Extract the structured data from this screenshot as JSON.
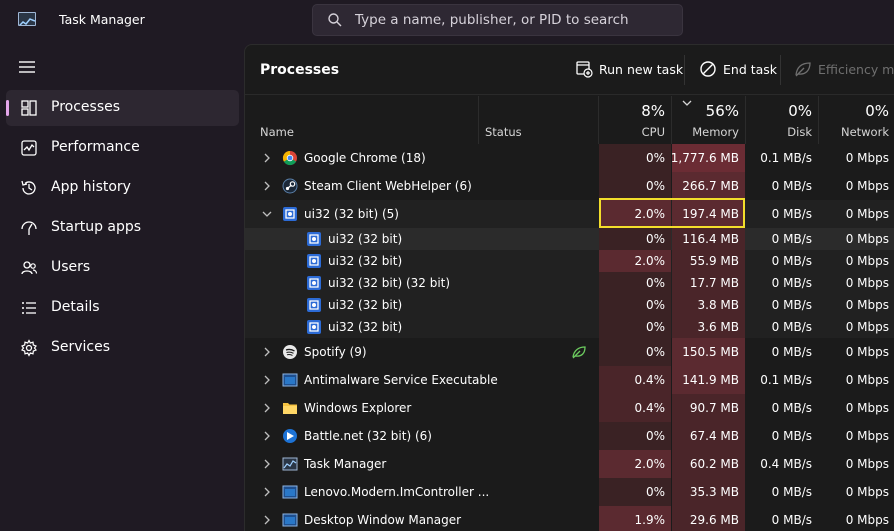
{
  "window": {
    "title": "Task Manager"
  },
  "search": {
    "placeholder": "Type a name, publisher, or PID to search"
  },
  "sidebar": {
    "items": [
      {
        "label": "Processes",
        "icon": "processes-icon",
        "active": true
      },
      {
        "label": "Performance",
        "icon": "performance-icon",
        "active": false
      },
      {
        "label": "App history",
        "icon": "history-icon",
        "active": false
      },
      {
        "label": "Startup apps",
        "icon": "startup-icon",
        "active": false
      },
      {
        "label": "Users",
        "icon": "users-icon",
        "active": false
      },
      {
        "label": "Details",
        "icon": "details-icon",
        "active": false
      },
      {
        "label": "Services",
        "icon": "services-icon",
        "active": false
      }
    ]
  },
  "toolbar": {
    "title": "Processes",
    "run_new_task": "Run new task",
    "end_task": "End task",
    "efficiency_mode": "Efficiency mod"
  },
  "columns": {
    "name": "Name",
    "status": "Status",
    "cpu": {
      "pct": "8%",
      "label": "CPU"
    },
    "memory": {
      "pct": "56%",
      "label": "Memory"
    },
    "disk": {
      "pct": "0%",
      "label": "Disk"
    },
    "network": {
      "pct": "0%",
      "label": "Network"
    }
  },
  "colors": {
    "accent": "#e4a6ea",
    "highlight": "#f3de2b",
    "heat_low": "#3a2224",
    "heat_med": "#4a2529",
    "heat_high": "#5b2a30"
  },
  "processes": [
    {
      "name": "Google Chrome (18)",
      "icon": "chrome-icon",
      "cpu": "0%",
      "memory": "1,777.6 MB",
      "disk": "0.1 MB/s",
      "network": "0 Mbps",
      "expandable": true,
      "expanded": false,
      "child": false,
      "eco": false
    },
    {
      "name": "Steam Client WebHelper (6)",
      "icon": "steam-icon",
      "cpu": "0%",
      "memory": "266.7 MB",
      "disk": "0 MB/s",
      "network": "0 Mbps",
      "expandable": true,
      "expanded": false,
      "child": false,
      "eco": false
    },
    {
      "name": "ui32 (32 bit) (5)",
      "icon": "ui32-icon",
      "cpu": "2.0%",
      "memory": "197.4 MB",
      "disk": "0 MB/s",
      "network": "0 Mbps",
      "expandable": true,
      "expanded": true,
      "child": false,
      "eco": false
    },
    {
      "name": "ui32 (32 bit)",
      "icon": "ui32-icon",
      "cpu": "0%",
      "memory": "116.4 MB",
      "disk": "0 MB/s",
      "network": "0 Mbps",
      "expandable": false,
      "child": true,
      "eco": false
    },
    {
      "name": "ui32 (32 bit)",
      "icon": "ui32-icon",
      "cpu": "2.0%",
      "memory": "55.9 MB",
      "disk": "0 MB/s",
      "network": "0 Mbps",
      "expandable": false,
      "child": true,
      "eco": false
    },
    {
      "name": "ui32 (32 bit) (32 bit)",
      "icon": "ui32-icon",
      "cpu": "0%",
      "memory": "17.7 MB",
      "disk": "0 MB/s",
      "network": "0 Mbps",
      "expandable": false,
      "child": true,
      "eco": false
    },
    {
      "name": "ui32 (32 bit)",
      "icon": "ui32-icon",
      "cpu": "0%",
      "memory": "3.8 MB",
      "disk": "0 MB/s",
      "network": "0 Mbps",
      "expandable": false,
      "child": true,
      "eco": false
    },
    {
      "name": "ui32 (32 bit)",
      "icon": "ui32-icon",
      "cpu": "0%",
      "memory": "3.6 MB",
      "disk": "0 MB/s",
      "network": "0 Mbps",
      "expandable": false,
      "child": true,
      "eco": false
    },
    {
      "name": "Spotify (9)",
      "icon": "spotify-icon",
      "cpu": "0%",
      "memory": "150.5 MB",
      "disk": "0 MB/s",
      "network": "0 Mbps",
      "expandable": true,
      "expanded": false,
      "child": false,
      "eco": true
    },
    {
      "name": "Antimalware Service Executable",
      "icon": "shield-app-icon",
      "cpu": "0.4%",
      "memory": "141.9 MB",
      "disk": "0.1 MB/s",
      "network": "0 Mbps",
      "expandable": true,
      "expanded": false,
      "child": false,
      "eco": false
    },
    {
      "name": "Windows Explorer",
      "icon": "folder-icon",
      "cpu": "0.4%",
      "memory": "90.7 MB",
      "disk": "0 MB/s",
      "network": "0 Mbps",
      "expandable": true,
      "expanded": false,
      "child": false,
      "eco": false
    },
    {
      "name": "Battle.net (32 bit) (6)",
      "icon": "battlenet-icon",
      "cpu": "0%",
      "memory": "67.4 MB",
      "disk": "0 MB/s",
      "network": "0 Mbps",
      "expandable": true,
      "expanded": false,
      "child": false,
      "eco": false
    },
    {
      "name": "Task Manager",
      "icon": "taskmanager-icon",
      "cpu": "2.0%",
      "memory": "60.2 MB",
      "disk": "0.4 MB/s",
      "network": "0 Mbps",
      "expandable": true,
      "expanded": false,
      "child": false,
      "eco": false
    },
    {
      "name": "Lenovo.Modern.ImController ...",
      "icon": "app-window-icon",
      "cpu": "0%",
      "memory": "35.3 MB",
      "disk": "0 MB/s",
      "network": "0 Mbps",
      "expandable": true,
      "expanded": false,
      "child": false,
      "eco": false
    },
    {
      "name": "Desktop Window Manager",
      "icon": "app-window-icon",
      "cpu": "1.9%",
      "memory": "29.6 MB",
      "disk": "0 MB/s",
      "network": "0 Mbps",
      "expandable": true,
      "expanded": false,
      "child": false,
      "eco": false
    }
  ]
}
